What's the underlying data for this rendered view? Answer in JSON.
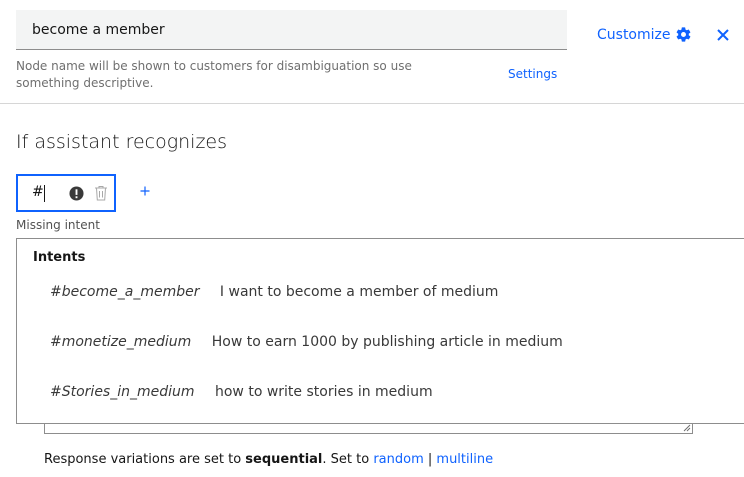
{
  "node": {
    "name_value": "become a member",
    "helper_text": "Node name will be shown to customers for disambiguation so use something descriptive.",
    "settings_label": "Settings",
    "customize_label": "Customize"
  },
  "condition": {
    "section_title": "If assistant recognizes",
    "input_value": "#",
    "error_text": "Missing intent"
  },
  "intents": {
    "heading": "Intents",
    "items": [
      {
        "name": "#become_a_member",
        "example": "I want to become a member of medium"
      },
      {
        "name": "#monetize_medium",
        "example": "How to earn 1000 by publishing article in medium"
      },
      {
        "name": "#Stories_in_medium",
        "example": "how to write stories in medium"
      }
    ]
  },
  "response": {
    "prefix": "Response variations are set to ",
    "mode": "sequential",
    "middle": ". Set to ",
    "option_random": "random",
    "separator": " | ",
    "option_multiline": "multiline"
  },
  "colors": {
    "accent": "#0f62fe",
    "warning": "#393939"
  },
  "icons": [
    "gear-icon",
    "close-icon",
    "warning-icon",
    "trash-icon",
    "plus-icon",
    "resize-handle-icon"
  ]
}
